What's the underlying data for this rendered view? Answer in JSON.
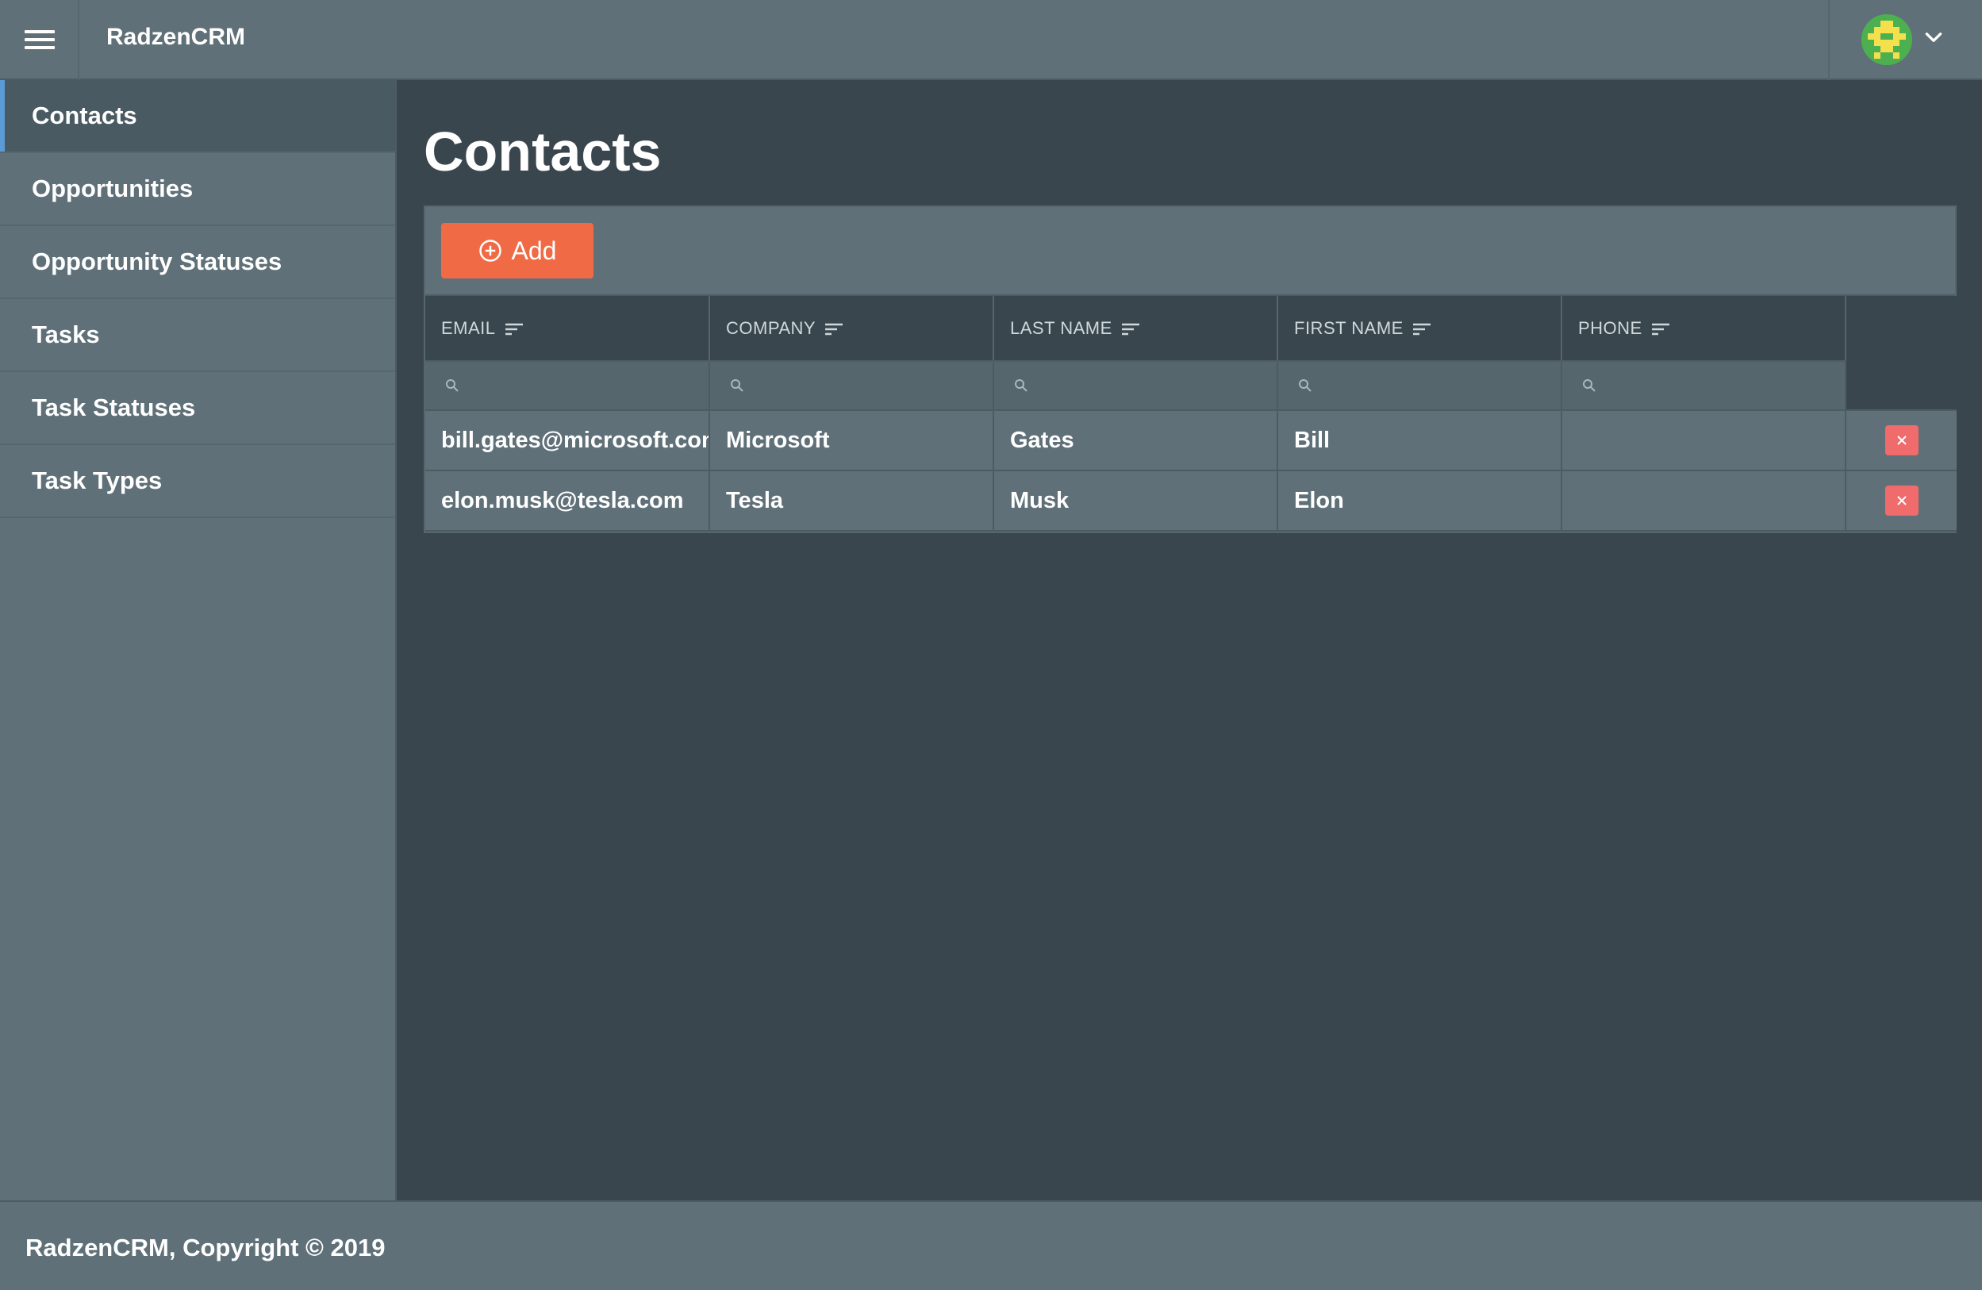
{
  "header": {
    "brand": "RadzenCRM"
  },
  "sidebar": {
    "items": [
      {
        "label": "Contacts",
        "active": true
      },
      {
        "label": "Opportunities"
      },
      {
        "label": "Opportunity Statuses"
      },
      {
        "label": "Tasks"
      },
      {
        "label": "Task Statuses"
      },
      {
        "label": "Task Types"
      }
    ]
  },
  "main": {
    "title": "Contacts",
    "add_label": "Add",
    "columns": [
      "EMAIL",
      "COMPANY",
      "LAST NAME",
      "FIRST NAME",
      "PHONE"
    ],
    "rows": [
      {
        "email": "bill.gates@microsoft.com",
        "company": "Microsoft",
        "last_name": "Gates",
        "first_name": "Bill",
        "phone": ""
      },
      {
        "email": "elon.musk@tesla.com",
        "company": "Tesla",
        "last_name": "Musk",
        "first_name": "Elon",
        "phone": ""
      }
    ]
  },
  "footer": {
    "text": "RadzenCRM, Copyright © 2019"
  },
  "colors": {
    "accent_orange": "#f06b45",
    "delete_red": "#f06b6b",
    "active_indicator": "#5b9bd5"
  },
  "icons": {
    "menu": "hamburger-menu-icon",
    "avatar": "user-avatar",
    "chevron": "chevron-down-icon",
    "add": "plus-circle-icon",
    "sort": "sort-icon",
    "filter": "search-icon",
    "delete": "close-icon"
  }
}
